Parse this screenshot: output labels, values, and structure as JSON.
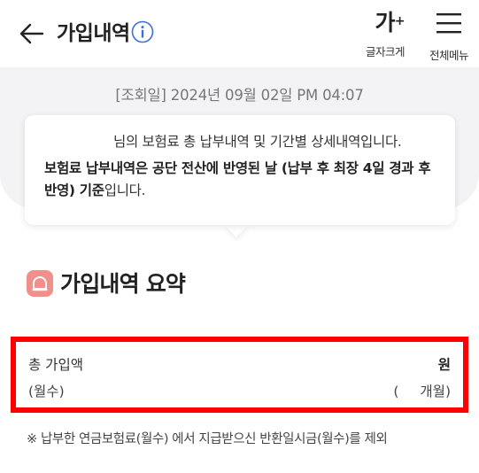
{
  "header": {
    "title": "가입내역",
    "font_size_label": "글자크게",
    "font_size_glyph": "가",
    "font_size_sup": "+",
    "menu_label": "전체메뉴"
  },
  "inquiry": {
    "date_text": "[조회일] 2024년 09월 02일 PM 04:07"
  },
  "notice": {
    "line1": "님의 보험료 총 납부내역 및 기간별 상세내역입니다.",
    "line2_bold": "보험료 납부내역은 공단 전산에 반영된 날 (납부 후 최장 4일 경과 후 반영) 기준",
    "line2_rest": "입니다."
  },
  "section": {
    "title": "가입내역 요약"
  },
  "summary": {
    "total_label": "총 가입액",
    "monthly_label": "(월수)",
    "total_value": "원",
    "months_open": "(",
    "months_close": "개월)"
  },
  "footnote": "※ 납부한 연금보험료(월수) 에서 지급받으신 반환일시금(월수)를 제외",
  "colors": {
    "accent_icon": "#f18f8a",
    "highlight_border": "#ff0000",
    "info_blue": "#3a6fd6",
    "gray_band": "#f3f3f5"
  }
}
